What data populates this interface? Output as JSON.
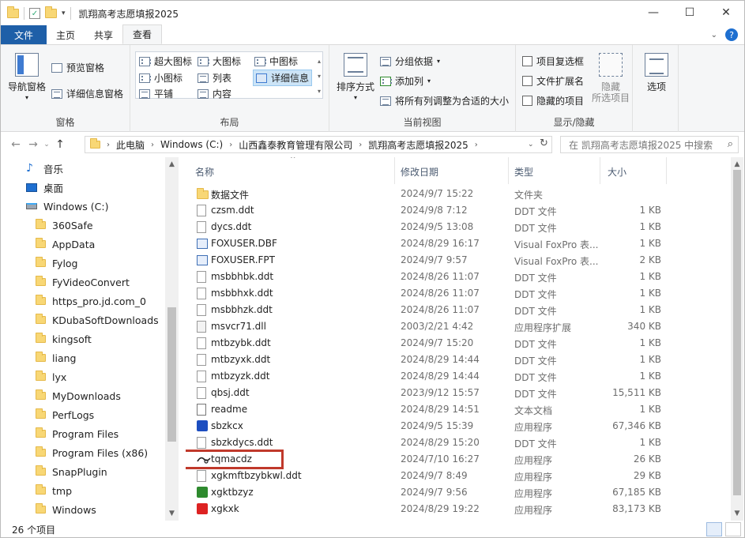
{
  "window": {
    "title": "凯翔高考志愿填报2025",
    "controls": [
      "—",
      "☐",
      "✕"
    ]
  },
  "ribbon_tabs": [
    {
      "label": "文件"
    },
    {
      "label": "主页"
    },
    {
      "label": "共享"
    },
    {
      "label": "查看"
    }
  ],
  "ribbon": {
    "panes": {
      "label": "窗格",
      "nav_pane": "导航窗格",
      "preview_pane": "预览窗格",
      "details_pane": "详细信息窗格"
    },
    "layout": {
      "label": "布局",
      "items": [
        "超大图标",
        "大图标",
        "中图标",
        "小图标",
        "列表",
        "详细信息",
        "平铺",
        "内容"
      ]
    },
    "current_view": {
      "label": "当前视图",
      "sort": "排序方式",
      "group_by": "分组依据",
      "add_column": "添加列",
      "fit_columns": "将所有列调整为合适的大小"
    },
    "show_hide": {
      "label": "显示/隐藏",
      "item_checkbox": "项目复选框",
      "file_ext": "文件扩展名",
      "hidden_items": "隐藏的项目",
      "hide": "隐藏",
      "hide_sub": "所选项目",
      "options": "选项"
    }
  },
  "address": {
    "crumbs": [
      "此电脑",
      "Windows (C:)",
      "山西鑫泰教育管理有限公司",
      "凯翔高考志愿填报2025"
    ],
    "search_placeholder": "在 凯翔高考志愿填报2025 中搜索"
  },
  "nav_pane": [
    {
      "label": "音乐",
      "icon": "music-icon"
    },
    {
      "label": "桌面",
      "icon": "desktop-icon"
    },
    {
      "label": "Windows (C:)",
      "icon": "drive-icon"
    },
    {
      "label": "360Safe",
      "icon": "folder-icon"
    },
    {
      "label": "AppData",
      "icon": "folder-icon"
    },
    {
      "label": "Fylog",
      "icon": "folder-icon"
    },
    {
      "label": "FyVideoConvert",
      "icon": "folder-icon"
    },
    {
      "label": "https_pro.jd.com_0",
      "icon": "folder-icon"
    },
    {
      "label": "KDubaSoftDownloads",
      "icon": "folder-icon"
    },
    {
      "label": "kingsoft",
      "icon": "folder-icon"
    },
    {
      "label": "liang",
      "icon": "folder-icon"
    },
    {
      "label": "lyx",
      "icon": "folder-icon"
    },
    {
      "label": "MyDownloads",
      "icon": "folder-icon"
    },
    {
      "label": "PerfLogs",
      "icon": "folder-icon"
    },
    {
      "label": "Program Files",
      "icon": "folder-icon"
    },
    {
      "label": "Program Files (x86)",
      "icon": "folder-icon"
    },
    {
      "label": "SnapPlugin",
      "icon": "folder-icon"
    },
    {
      "label": "tmp",
      "icon": "folder-icon"
    },
    {
      "label": "Windows",
      "icon": "folder-icon"
    }
  ],
  "columns": {
    "name": "名称",
    "date": "修改日期",
    "type": "类型",
    "size": "大小"
  },
  "files": [
    {
      "name": "数据文件",
      "date": "2024/9/7 15:22",
      "type": "文件夹",
      "size": "",
      "icon": "folder"
    },
    {
      "name": "czsm.ddt",
      "date": "2024/9/8 7:12",
      "type": "DDT 文件",
      "size": "1 KB",
      "icon": "file"
    },
    {
      "name": "dycs.ddt",
      "date": "2024/9/5 13:08",
      "type": "DDT 文件",
      "size": "1 KB",
      "icon": "file"
    },
    {
      "name": "FOXUSER.DBF",
      "date": "2024/8/29 16:17",
      "type": "Visual FoxPro 表...",
      "size": "1 KB",
      "icon": "dbf"
    },
    {
      "name": "FOXUSER.FPT",
      "date": "2024/9/7 9:57",
      "type": "Visual FoxPro 表...",
      "size": "2 KB",
      "icon": "dbf"
    },
    {
      "name": "msbbhbk.ddt",
      "date": "2024/8/26 11:07",
      "type": "DDT 文件",
      "size": "1 KB",
      "icon": "file"
    },
    {
      "name": "msbbhxk.ddt",
      "date": "2024/8/26 11:07",
      "type": "DDT 文件",
      "size": "1 KB",
      "icon": "file"
    },
    {
      "name": "msbbhzk.ddt",
      "date": "2024/8/26 11:07",
      "type": "DDT 文件",
      "size": "1 KB",
      "icon": "file"
    },
    {
      "name": "msvcr71.dll",
      "date": "2003/2/21 4:42",
      "type": "应用程序扩展",
      "size": "340 KB",
      "icon": "dll"
    },
    {
      "name": "mtbzybk.ddt",
      "date": "2024/9/7 15:20",
      "type": "DDT 文件",
      "size": "1 KB",
      "icon": "file"
    },
    {
      "name": "mtbzyxk.ddt",
      "date": "2024/8/29 14:44",
      "type": "DDT 文件",
      "size": "1 KB",
      "icon": "file"
    },
    {
      "name": "mtbzyzk.ddt",
      "date": "2024/8/29 14:44",
      "type": "DDT 文件",
      "size": "1 KB",
      "icon": "file"
    },
    {
      "name": "qbsj.ddt",
      "date": "2023/9/12 15:57",
      "type": "DDT 文件",
      "size": "15,511 KB",
      "icon": "file"
    },
    {
      "name": "readme",
      "date": "2024/8/29 14:51",
      "type": "文本文档",
      "size": "1 KB",
      "icon": "txt"
    },
    {
      "name": "sbzkcx",
      "date": "2024/9/5 15:39",
      "type": "应用程序",
      "size": "67,346 KB",
      "icon": "app"
    },
    {
      "name": "sbzkdycs.ddt",
      "date": "2024/8/29 15:20",
      "type": "DDT 文件",
      "size": "1 KB",
      "icon": "file"
    },
    {
      "name": "tqmacdz",
      "date": "2024/7/10 16:27",
      "type": "应用程序",
      "size": "26 KB",
      "icon": "tq",
      "highlight": true
    },
    {
      "name": "xgkmftbzybkwl.ddt",
      "date": "2024/9/7 8:49",
      "type": "应用程序",
      "size": "29 KB",
      "icon": "file"
    },
    {
      "name": "xgktbzyz",
      "date": "2024/9/7 9:56",
      "type": "应用程序",
      "size": "67,185 KB",
      "icon": "app2"
    },
    {
      "name": "xgkxk",
      "date": "2024/8/29 19:22",
      "type": "应用程序",
      "size": "83,173 KB",
      "icon": "app3"
    }
  ],
  "status": {
    "count": "26 个项目"
  }
}
